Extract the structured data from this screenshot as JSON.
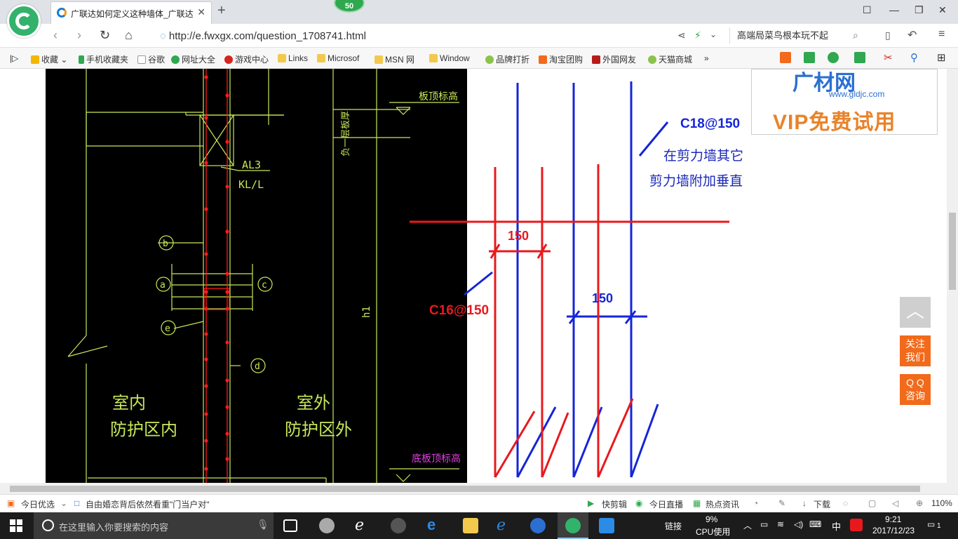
{
  "browser": {
    "tab_title": "广联达如何定义这种墙体_广联达",
    "tab_close": "✕",
    "new_tab": "+",
    "badge": "50",
    "url": "http://e.fwxgx.com/question_1708741.html",
    "search_text": "高端局菜鸟根本玩不起"
  },
  "bookmarks": [
    {
      "label": "收藏",
      "color": "#f2b705"
    },
    {
      "label": "手机收藏夹",
      "color": "#2fa84f"
    },
    {
      "label": "谷歌",
      "color": "#ffffff"
    },
    {
      "label": "网址大全",
      "color": "#2fa84f"
    },
    {
      "label": "游戏中心",
      "color": "#d6241c"
    },
    {
      "label": "Links",
      "color": "#f2c94c"
    },
    {
      "label": "Microsof",
      "color": "#f2c94c"
    },
    {
      "label": "MSN 网",
      "color": "#f2c94c"
    },
    {
      "label": "Window",
      "color": "#f2c94c"
    },
    {
      "label": "品牌打折",
      "color": "#8bc34a"
    },
    {
      "label": "淘宝团购",
      "color": "#f26a1b"
    },
    {
      "label": "外国网友",
      "color": "#b71c1c"
    },
    {
      "label": "天猫商城",
      "color": "#8bc34a"
    }
  ],
  "cad": {
    "label_al3": "AL3",
    "label_kll": "KL/L",
    "label_b": "b",
    "label_a": "a",
    "label_c": "c",
    "label_e": "e",
    "label_d": "d",
    "label_h1": "h1",
    "label_slab_top": "板顶标高",
    "label_slab_thick": "负一层板厚",
    "label_bottom_top": "底板顶标高",
    "label_indoor_1": "室内",
    "label_indoor_2": "防护区内",
    "label_outdoor_1": "室外",
    "label_outdoor_2": "防护区外"
  },
  "sketch": {
    "label_c18": "C18@150",
    "label_c16": "C16@150",
    "label_150_top": "150",
    "label_150_bottom": "150",
    "note_line1": "在剪力墙其它钢筋中输入",
    "note_line2": "剪力墙附加垂直钢筋"
  },
  "ad": {
    "logo": "广材网",
    "site": "www.gldjc.com",
    "vip": "VIP免费试用"
  },
  "side_buttons": {
    "top": "︿",
    "follow_1": "关注",
    "follow_2": "我们",
    "qq_1": "Q Q",
    "qq_2": "咨询"
  },
  "statusbar": {
    "today": "今日优选",
    "news": "自由婚恋背后依然看重\"门当户对\"",
    "quick_clip": "快剪辑",
    "live": "今日直播",
    "hot": "热点资讯",
    "download": "下载",
    "zoom": "110%"
  },
  "taskbar": {
    "search_placeholder": "在这里输入你要搜索的内容",
    "links": "链接",
    "cpu_pct": "9%",
    "cpu_label": "CPU使用",
    "ime": "中",
    "time": "9:21",
    "date": "2017/12/23",
    "notif": "1"
  },
  "colors": {
    "cad_bg": "#000000",
    "cad_line": "#c8e85a",
    "rebar_red": "#ff1a1a",
    "sketch_red": "#e8191d",
    "sketch_blue": "#1525d8",
    "accent_orange": "#f26a1b"
  }
}
